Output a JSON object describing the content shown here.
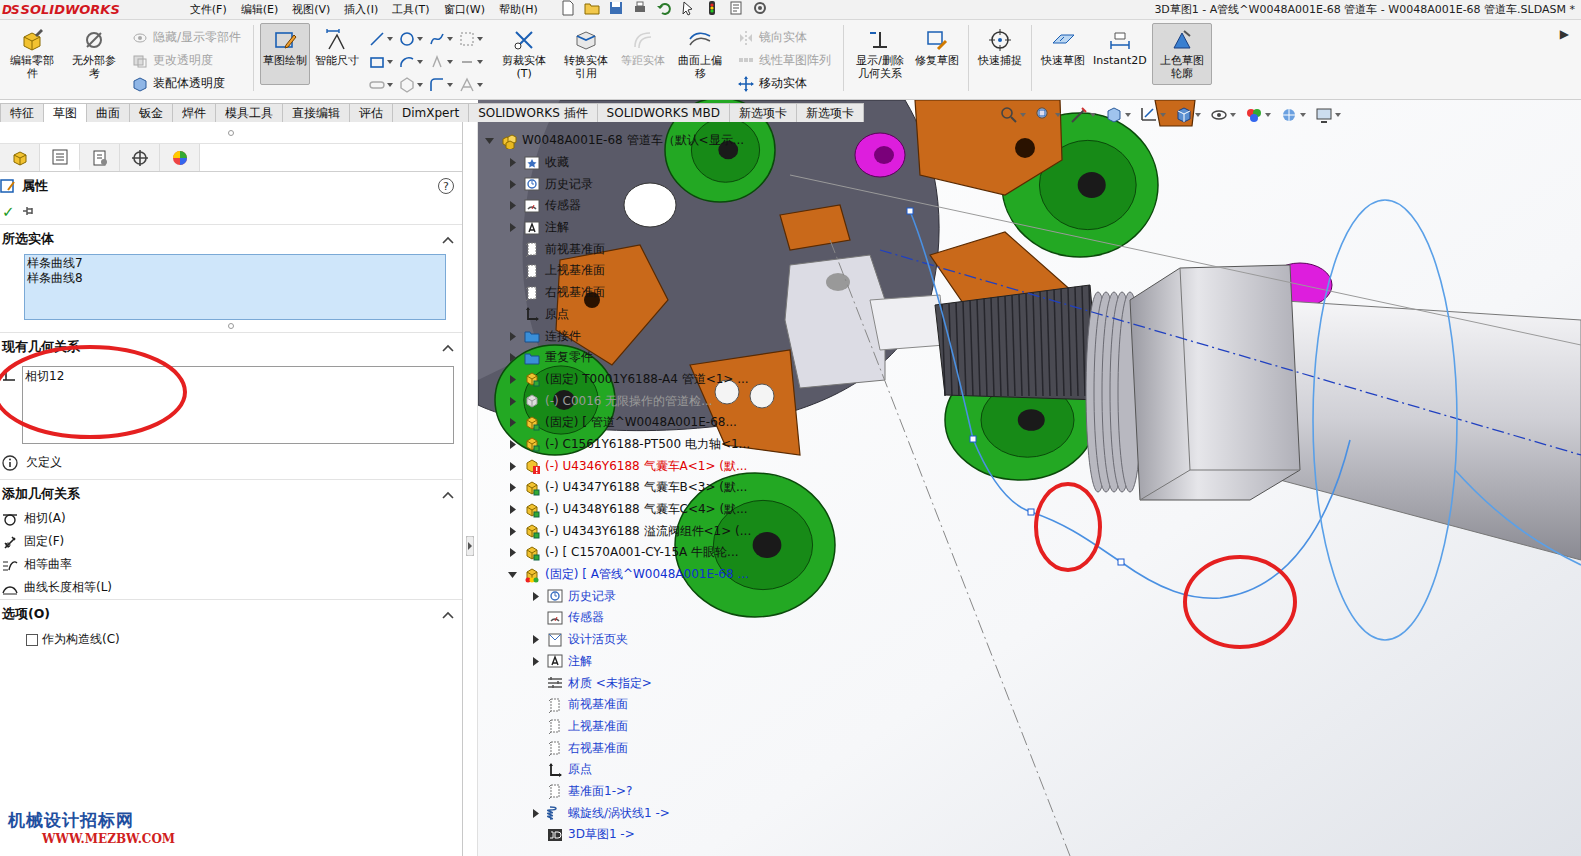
{
  "window": {
    "title": "3D草图1 - A管线^W0048A001E-68 管道车 - W0048A001E-68 管道车.SLDASM *"
  },
  "logo": {
    "mark": "DS",
    "text": "SOLIDWORKS"
  },
  "menu": [
    "文件(F)",
    "编辑(E)",
    "视图(V)",
    "插入(I)",
    "工具(T)",
    "窗口(W)",
    "帮助(H)"
  ],
  "ribbon": {
    "more": "▶",
    "items": [
      {
        "kind": "big",
        "label": "编辑零部件",
        "disabled": false,
        "pressed": false
      },
      {
        "kind": "big",
        "label": "无外部参考",
        "disabled": false,
        "pressed": false
      },
      {
        "kind": "stack",
        "entries": [
          {
            "label": "隐藏/显示零部件",
            "disabled": true
          },
          {
            "label": "更改透明度",
            "disabled": true
          },
          {
            "label": "装配体透明度",
            "disabled": false
          }
        ]
      },
      {
        "kind": "sep"
      },
      {
        "kind": "big",
        "label": "草图绘制",
        "disabled": false,
        "pressed": true
      },
      {
        "kind": "big",
        "label": "智能尺寸",
        "disabled": false,
        "pressed": false
      },
      {
        "kind": "tools"
      },
      {
        "kind": "big",
        "label": "剪裁实体(T)",
        "disabled": false,
        "pressed": false
      },
      {
        "kind": "big",
        "label": "转换实体引用",
        "disabled": false,
        "pressed": false
      },
      {
        "kind": "big",
        "label": "等距实体",
        "disabled": true,
        "pressed": false
      },
      {
        "kind": "big",
        "label": "曲面上偏移",
        "disabled": false,
        "pressed": false
      },
      {
        "kind": "stack",
        "entries": [
          {
            "label": "镜向实体",
            "disabled": true
          },
          {
            "label": "线性草图阵列",
            "disabled": true
          },
          {
            "label": "移动实体",
            "disabled": false
          }
        ]
      },
      {
        "kind": "sep"
      },
      {
        "kind": "big",
        "label": "显示/删除几何关系",
        "disabled": false,
        "pressed": false
      },
      {
        "kind": "big",
        "label": "修复草图",
        "disabled": false,
        "pressed": false
      },
      {
        "kind": "sep"
      },
      {
        "kind": "big",
        "label": "快速捕捉",
        "disabled": false,
        "pressed": false
      },
      {
        "kind": "sep"
      },
      {
        "kind": "big",
        "label": "快速草图",
        "disabled": false,
        "pressed": false
      },
      {
        "kind": "big",
        "label": "Instant2D",
        "disabled": false,
        "pressed": false
      },
      {
        "kind": "big",
        "label": "上色草图轮廓",
        "disabled": false,
        "pressed": true
      }
    ]
  },
  "tabs": [
    {
      "label": "特征",
      "selected": false
    },
    {
      "label": "草图",
      "selected": true
    },
    {
      "label": "曲面",
      "selected": false
    },
    {
      "label": "钣金",
      "selected": false
    },
    {
      "label": "焊件",
      "selected": false
    },
    {
      "label": "模具工具",
      "selected": false
    },
    {
      "label": "直接编辑",
      "selected": false
    },
    {
      "label": "评估",
      "selected": false
    },
    {
      "label": "DimXpert",
      "selected": false
    },
    {
      "label": "SOLIDWORKS 插件",
      "selected": false
    },
    {
      "label": "SOLIDWORKS MBD",
      "selected": false
    },
    {
      "label": "新选项卡",
      "selected": false
    },
    {
      "label": "新选项卡",
      "selected": false
    }
  ],
  "property_manager": {
    "title": "属性",
    "help": "?",
    "ok": "✓",
    "panel_tabs": [
      {
        "selected": false
      },
      {
        "selected": true
      },
      {
        "selected": false
      },
      {
        "selected": false
      },
      {
        "selected": false
      }
    ],
    "selected_entities": {
      "header": "所选实体",
      "items": [
        "样条曲线7",
        "样条曲线8"
      ]
    },
    "existing_relations": {
      "header": "现有几何关系",
      "items": [
        "相切12"
      ],
      "status": "欠定义"
    },
    "add_relations": {
      "header": "添加几何关系",
      "items": [
        "相切(A)",
        "固定(F)",
        "相等曲率",
        "曲线长度相等(L)"
      ]
    },
    "options": {
      "header": "选项(O)",
      "construction": {
        "label": "作为构造线(C)",
        "checked": false
      }
    }
  },
  "tree": {
    "root": {
      "label": "W0048A001E-68 管道车（默认<显示...",
      "kind": "assembly",
      "expandable": true,
      "expanded": true,
      "color": "#111111",
      "children": [
        {
          "label": "收藏",
          "kind": "favorites",
          "expandable": true,
          "expanded": false,
          "color": "#111111"
        },
        {
          "label": "历史记录",
          "kind": "history",
          "expandable": true,
          "expanded": false,
          "color": "#111111"
        },
        {
          "label": "传感器",
          "kind": "sensor",
          "expandable": true,
          "expanded": false,
          "color": "#111111"
        },
        {
          "label": "注解",
          "kind": "annotation",
          "expandable": true,
          "expanded": false,
          "color": "#111111"
        },
        {
          "label": "前视基准面",
          "kind": "plane",
          "expandable": false,
          "expanded": false,
          "color": "#111111"
        },
        {
          "label": "上视基准面",
          "kind": "plane",
          "expandable": false,
          "expanded": false,
          "color": "#111111"
        },
        {
          "label": "右视基准面",
          "kind": "plane",
          "expandable": false,
          "expanded": false,
          "color": "#111111"
        },
        {
          "label": "原点",
          "kind": "origin",
          "expandable": false,
          "expanded": false,
          "color": "#111111"
        },
        {
          "label": "连接件",
          "kind": "folder",
          "expandable": true,
          "expanded": false,
          "color": "#111111"
        },
        {
          "label": "重复零件",
          "kind": "folder",
          "expandable": true,
          "expanded": false,
          "color": "#111111"
        },
        {
          "label": "(固定) T0001Y6188-A4 管道<1> ...",
          "kind": "component",
          "expandable": true,
          "expanded": false,
          "color": "#111111"
        },
        {
          "label": "(-) C0016 无限操作的管道检...",
          "kind": "component-grey",
          "expandable": true,
          "expanded": false,
          "color": "#9a9a9a"
        },
        {
          "label": "(固定) [ 管道^W0048A001E-68...",
          "kind": "component",
          "expandable": true,
          "expanded": false,
          "color": "#111111"
        },
        {
          "label": "(-) C1561Y6188-PT500 电力轴<1...",
          "kind": "component",
          "expandable": true,
          "expanded": false,
          "color": "#111111"
        },
        {
          "label": "(-) U4346Y6188 气囊车A<1> (默...",
          "kind": "component-error",
          "expandable": true,
          "expanded": false,
          "color": "#e00000"
        },
        {
          "label": "(-) U4347Y6188 气囊车B<3> (默...",
          "kind": "component",
          "expandable": true,
          "expanded": false,
          "color": "#111111"
        },
        {
          "label": "(-) U4348Y6188 气囊车C<4> (默...",
          "kind": "component",
          "expandable": true,
          "expanded": false,
          "color": "#111111"
        },
        {
          "label": "(-) U4343Y6188 溢流阀组件<1> (...",
          "kind": "component",
          "expandable": true,
          "expanded": false,
          "color": "#111111"
        },
        {
          "label": "(-) [ C1570A001-CY-15A 牛眼轮...",
          "kind": "component",
          "expandable": true,
          "expanded": false,
          "color": "#111111"
        },
        {
          "label": "(固定) [ A管线^W0048A001E-68 ...",
          "kind": "component-edit",
          "expandable": true,
          "expanded": true,
          "color": "#1030d0",
          "children": [
            {
              "label": "历史记录",
              "kind": "history",
              "expandable": true,
              "expanded": false,
              "color": "#1a3fcf"
            },
            {
              "label": "传感器",
              "kind": "sensor",
              "expandable": false,
              "expanded": false,
              "color": "#1a3fcf"
            },
            {
              "label": "设计活页夹",
              "kind": "binder",
              "expandable": true,
              "expanded": false,
              "color": "#1a3fcf"
            },
            {
              "label": "注解",
              "kind": "annotation",
              "expandable": true,
              "expanded": false,
              "color": "#1a3fcf"
            },
            {
              "label": "材质 <未指定>",
              "kind": "material",
              "expandable": false,
              "expanded": false,
              "color": "#1a3fcf"
            },
            {
              "label": "前视基准面",
              "kind": "plane",
              "expandable": false,
              "expanded": false,
              "color": "#1a3fcf"
            },
            {
              "label": "上视基准面",
              "kind": "plane",
              "expandable": false,
              "expanded": false,
              "color": "#1a3fcf"
            },
            {
              "label": "右视基准面",
              "kind": "plane",
              "expandable": false,
              "expanded": false,
              "color": "#1a3fcf"
            },
            {
              "label": "原点",
              "kind": "origin",
              "expandable": false,
              "expanded": false,
              "color": "#1a3fcf"
            },
            {
              "label": "基准面1->?",
              "kind": "plane",
              "expandable": false,
              "expanded": false,
              "color": "#1a3fcf"
            },
            {
              "label": "螺旋线/涡状线1 ->",
              "kind": "helix",
              "expandable": true,
              "expanded": false,
              "color": "#1a3fcf"
            },
            {
              "label": "3D草图1 ->",
              "kind": "sketch3d",
              "expandable": false,
              "expanded": false,
              "color": "#1a3fcf"
            }
          ]
        }
      ]
    }
  },
  "watermark": {
    "line1": "机械设计招标网",
    "line2": "WWW.MEZBW.COM"
  }
}
